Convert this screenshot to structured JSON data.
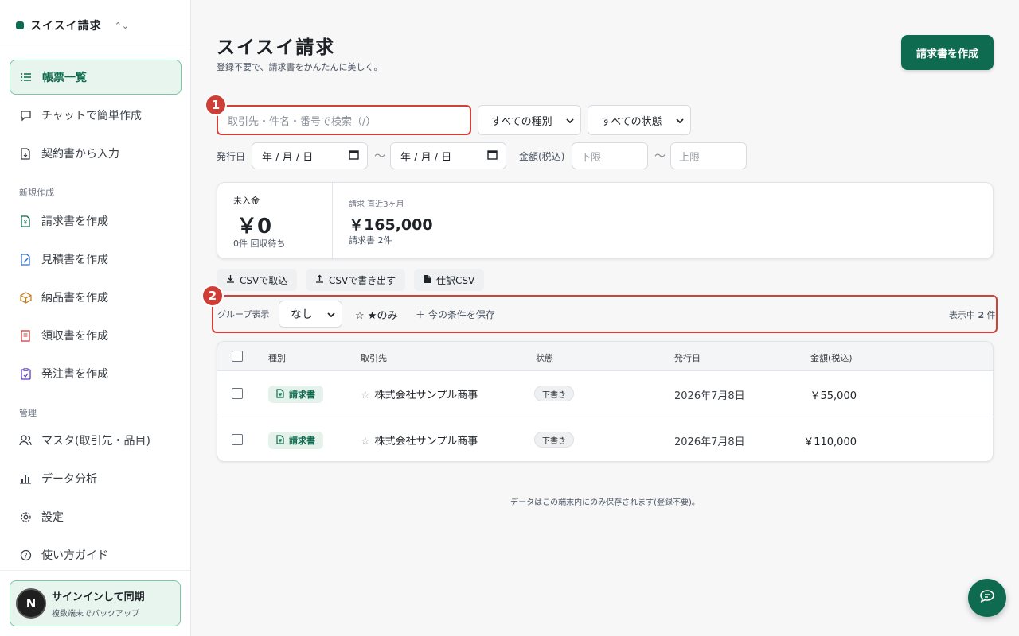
{
  "sidebar": {
    "app_name": "スイスイ請求",
    "primary": [
      {
        "label": "帳票一覧",
        "icon": "list-icon"
      },
      {
        "label": "チャットで簡単作成",
        "icon": "chat-icon"
      },
      {
        "label": "契約書から入力",
        "icon": "file-import-icon"
      }
    ],
    "section_new": "新規作成",
    "new_items": [
      {
        "label": "請求書を作成",
        "icon": "invoice-icon"
      },
      {
        "label": "見積書を作成",
        "icon": "quote-edit-icon"
      },
      {
        "label": "納品書を作成",
        "icon": "box-icon"
      },
      {
        "label": "領収書を作成",
        "icon": "receipt-icon"
      },
      {
        "label": "発注書を作成",
        "icon": "clipboard-icon"
      }
    ],
    "section_manage": "管理",
    "manage_items": [
      {
        "label": "マスタ(取引先・品目)",
        "icon": "users-icon"
      },
      {
        "label": "データ分析",
        "icon": "bar-chart-icon"
      },
      {
        "label": "設定",
        "icon": "gear-icon"
      },
      {
        "label": "使い方ガイド",
        "icon": "help-icon"
      }
    ],
    "signin": {
      "avatar_letter": "N",
      "title": "サインインして同期",
      "subtitle": "複数端末でバックアップ"
    }
  },
  "header": {
    "title": "スイスイ請求",
    "subtitle": "登録不要で、請求書をかんたんに美しく。",
    "create_button": "請求書を作成"
  },
  "filters": {
    "search_placeholder": "取引先・件名・番号で検索（/）",
    "type_select": "すべての種別",
    "status_select": "すべての状態",
    "issued_label": "発行日",
    "date_from": "年 / 月 / 日",
    "date_to": "年 / 月 / 日",
    "tilde": "〜",
    "amount_label": "金額(税込)",
    "amount_min_placeholder": "下限",
    "amount_max_placeholder": "上限"
  },
  "callouts": [
    "1",
    "2"
  ],
  "summary": {
    "unpaid_label": "未入金",
    "unpaid_value": "￥0",
    "unpaid_sub": "0件 回収待ち",
    "billed_label": "請求 直近3ヶ月",
    "billed_value": "￥165,000",
    "billed_sub": "請求書 2件"
  },
  "tools": {
    "csv_import": "CSVで取込",
    "csv_export": "CSVで書き出す",
    "journal_csv": "仕訳CSV"
  },
  "grouping": {
    "label": "グループ表示",
    "value": "なし",
    "star_only": "☆ ★のみ",
    "save_conditions": "＋ 今の条件を保存",
    "count_prefix": "表示中",
    "count_value": "2",
    "count_suffix": "件"
  },
  "table": {
    "headers": {
      "kind": "種別",
      "client": "取引先",
      "status": "状態",
      "issued": "発行日",
      "amount": "金額(税込)"
    },
    "rows": [
      {
        "kind": "請求書",
        "client": "株式会社サンプル商事",
        "status": "下書き",
        "issued": "2026年7月8日",
        "amount": "￥55,000"
      },
      {
        "kind": "請求書",
        "client": "株式会社サンプル商事",
        "status": "下書き",
        "issued": "2026年7月8日",
        "amount": "￥110,000"
      }
    ]
  },
  "footer_note": "データはこの端末内にのみ保存されます(登録不要)。",
  "colors": {
    "accent": "#0f6b4f",
    "callout": "#cf3e36",
    "accent_light": "#e8f4ee"
  }
}
